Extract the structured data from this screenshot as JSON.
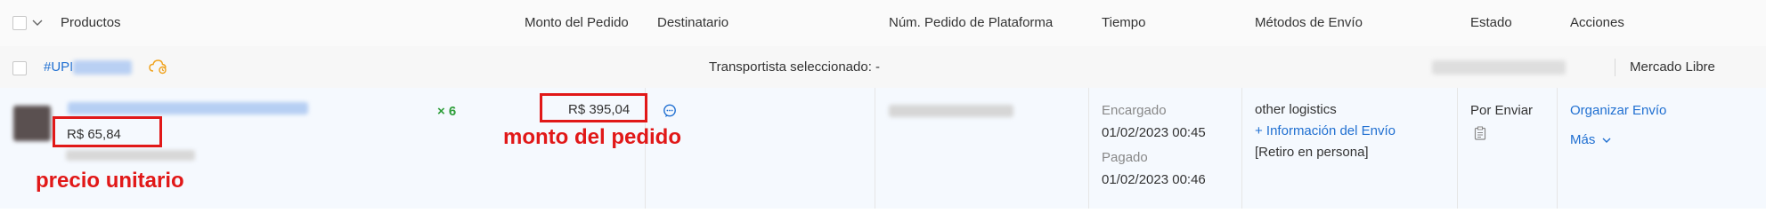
{
  "header": {
    "productos": "Productos",
    "monto": "Monto del Pedido",
    "destinatario": "Destinatario",
    "num_pedido": "Núm. Pedido de Plataforma",
    "tiempo": "Tiempo",
    "metodos": "Métodos de Envío",
    "estado": "Estado",
    "acciones": "Acciones"
  },
  "group": {
    "order_prefix": "#UPI",
    "transportista": "Transportista seleccionado: -",
    "platform": "Mercado Libre"
  },
  "order": {
    "unit_price": "R$ 65,84",
    "quantity": "× 6",
    "total": "R$ 395,04",
    "tiempo": {
      "encargado_label": "Encargado",
      "encargado_value": "01/02/2023 00:45",
      "pagado_label": "Pagado",
      "pagado_value": "01/02/2023 00:46"
    },
    "envio": {
      "method": "other logistics",
      "info_link": "+ Información del Envío",
      "retiro": "[Retiro en persona]"
    },
    "estado": "Por Enviar",
    "acciones": {
      "organizar": "Organizar Envío",
      "mas": "Más"
    }
  },
  "annotations": {
    "monto": "monto del pedido",
    "precio": "precio unitario"
  },
  "colors": {
    "link": "#1f6fd1",
    "quantity_green": "#2e9e3a",
    "annotation_red": "#e11818",
    "cloud_icon": "#f0a21c"
  }
}
